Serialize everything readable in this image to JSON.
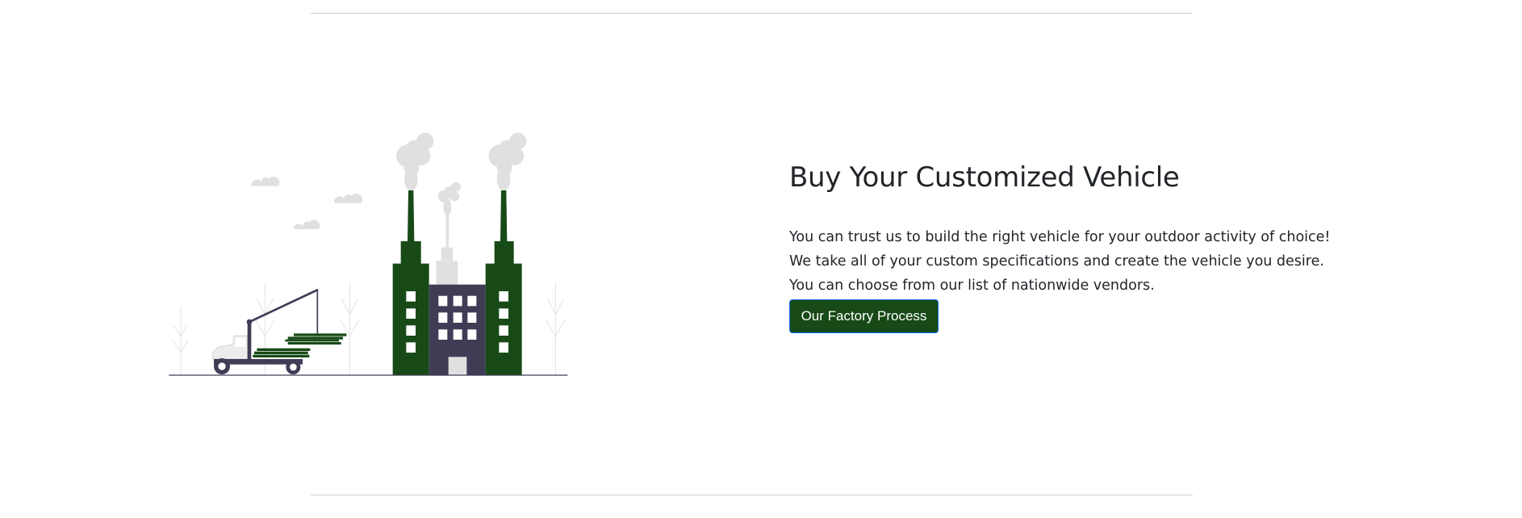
{
  "section": {
    "heading": "Buy Your Customized Vehicle",
    "paragraph_lines": [
      "You can trust us to build the right vehicle for your outdoor activity of choice!",
      "We take all of your custom specifications and create the vehicle you desire.",
      "You can choose from our list of nationwide vendors."
    ],
    "button_label": "Our Factory Process"
  },
  "illustration": {
    "icon": "factory-with-crane-truck-illustration",
    "colors": {
      "green": "#174a17",
      "dark": "#3f3d56",
      "smoke": "#e0e0e0"
    }
  },
  "colors": {
    "button_bg": "#174a17",
    "button_border": "#0d6efd",
    "text": "#212529"
  }
}
